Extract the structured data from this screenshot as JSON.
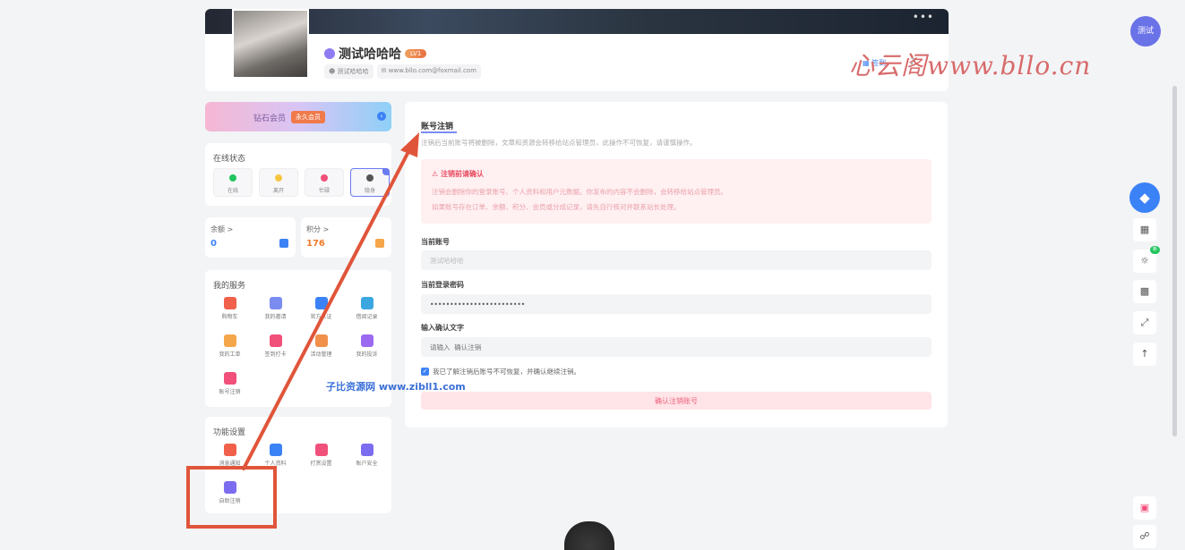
{
  "profile": {
    "username": "测试哈哈哈",
    "level": "LV1",
    "tag_name": "测试哈哈哈",
    "tag_email": "www.bllo.com@foxmail.com",
    "edit_label": "签到",
    "more_icon": "•••"
  },
  "watermarks": {
    "top": "心云阁www.bllo.cn",
    "mid": "子比资源网 www.zibll1.com"
  },
  "vip_banner": {
    "label": "钻石会员",
    "badge": "永久会员"
  },
  "online_status": {
    "title": "在线状态",
    "items": [
      {
        "label": "在线",
        "color": "#22c55e"
      },
      {
        "label": "离开",
        "color": "#f5c542"
      },
      {
        "label": "忙碌",
        "color": "#f0507a"
      },
      {
        "label": "隐身",
        "color": "#555555"
      }
    ]
  },
  "balance": {
    "label": "余额 >",
    "value": "0"
  },
  "points": {
    "label": "积分 >",
    "value": "176"
  },
  "services": {
    "title": "我的服务",
    "items": [
      {
        "label": "购物车",
        "color": "#f0604a"
      },
      {
        "label": "我的邀请",
        "color": "#7b8cf0"
      },
      {
        "label": "官方认证",
        "color": "#3b82f6"
      },
      {
        "label": "借阅记录",
        "color": "#3ba7e0"
      },
      {
        "label": "我的工单",
        "color": "#f5a64a"
      },
      {
        "label": "签到打卡",
        "color": "#f0507a"
      },
      {
        "label": "活动管理",
        "color": "#f0904a"
      },
      {
        "label": "我的投诉",
        "color": "#9b6af0"
      },
      {
        "label": "账号注销",
        "color": "#f0507a"
      }
    ]
  },
  "functions": {
    "title": "功能设置",
    "items": [
      {
        "label": "消息通知",
        "color": "#f0604a"
      },
      {
        "label": "个人资料",
        "color": "#3b82f6"
      },
      {
        "label": "打赏设置",
        "color": "#f0507a"
      },
      {
        "label": "账户安全",
        "color": "#7b6cf0"
      },
      {
        "label": "自助注销",
        "color": "#7b6cf0"
      }
    ]
  },
  "main": {
    "title": "账号注销",
    "description": "注销后当前账号将被删除，文章和资源会转移给站点管理员，此操作不可恢复，请谨慎操作。",
    "warning": {
      "title": "注销前请确认",
      "line1": "注销会删除你的登录账号、个人资料和用户元数据。你发布的内容不会删除，会转移给站点管理员。",
      "line2": "如果账号存在订单、余额、积分、会员或分成记录，请先自行核对并联系站长处理。"
    },
    "account_label": "当前账号",
    "account_value": "测试哈哈哈",
    "password_label": "当前登录密码",
    "password_value": "••••••••••••••••••••••••",
    "confirm_label": "输入确认文字",
    "confirm_placeholder": "请输入  确认注销",
    "agree_text": "我已了解注销后账号不可恢复，并确认继续注销。",
    "submit_label": "确认注销账号"
  },
  "toolbar": {
    "avatar_label": "测试",
    "new_badge": "新"
  },
  "annotation_color": "#e0553a"
}
